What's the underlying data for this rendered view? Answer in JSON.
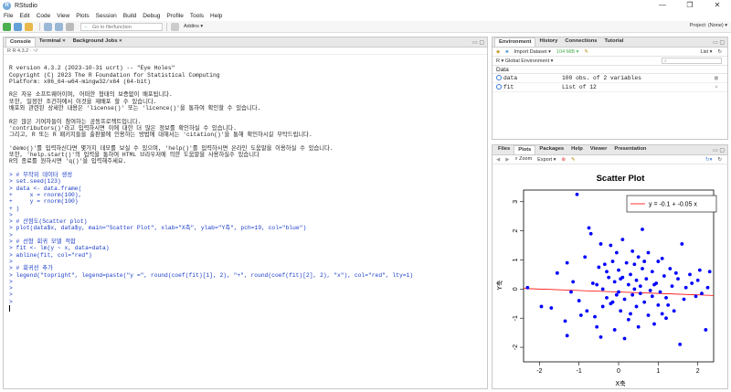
{
  "window": {
    "title": "RStudio"
  },
  "menu": [
    "File",
    "Edit",
    "Code",
    "View",
    "Plots",
    "Session",
    "Build",
    "Debug",
    "Profile",
    "Tools",
    "Help"
  ],
  "toolbar": {
    "goto_placeholder": "Go to file/function",
    "addins": "Addins ▾",
    "project": "Project: (None) ▾"
  },
  "left_pane": {
    "tabs": [
      "Console",
      "Terminal ×",
      "Background Jobs ×"
    ],
    "subheader": "R  R 4.3.2 · ~/",
    "lines": [
      {
        "t": "",
        "c": "out"
      },
      {
        "t": "R version 4.3.2 (2023-10-31 ucrt) -- \"Eye Holes\"",
        "c": "out"
      },
      {
        "t": "Copyright (C) 2023 The R Foundation for Statistical Computing",
        "c": "out"
      },
      {
        "t": "Platform: x86_64-w64-mingw32/x64 (64-bit)",
        "c": "out"
      },
      {
        "t": "",
        "c": "out"
      },
      {
        "t": "R은 자유 소프트웨어이며, 어떠한 형태의 보증없이 배포됩니다.",
        "c": "out"
      },
      {
        "t": "또한, 일정한 조건하에서 이것을 재배포 할 수 있습니다.",
        "c": "out"
      },
      {
        "t": "배포와 관련된 상세한 내용은 'license()' 또는 'licence()'을 통하여 확인할 수 있습니다.",
        "c": "out"
      },
      {
        "t": "",
        "c": "out"
      },
      {
        "t": "R은 많은 기여자들이 참여하는 공동프로젝트입니다.",
        "c": "out"
      },
      {
        "t": "'contributors()'라고 입력하시면 이에 대한 더 많은 정보를 확인하실 수 있습니다.",
        "c": "out"
      },
      {
        "t": "그리고, R 또는 R 패키지들을 출판물에 인용하는 방법에 대해서는 'citation()'을 통해 확인하시길 부탁드립니다.",
        "c": "out"
      },
      {
        "t": "",
        "c": "out"
      },
      {
        "t": "'demo()'를 입력하신다면 몇가지 데모를 보실 수 있으며, 'help()'를 입력하시면 온라인 도움말을 이용하실 수 있습니다.",
        "c": "out"
      },
      {
        "t": "또한, 'help.start()'의 입력을 통하여 HTML 브라우저에 의한 도움말을 사용하실수 있습니다",
        "c": "out"
      },
      {
        "t": "R의 종료를 원하시면 'q()'을 입력해주세요.",
        "c": "out"
      },
      {
        "t": "",
        "c": "out"
      },
      {
        "t": "> # 무작위 데이터 생성",
        "c": "input"
      },
      {
        "t": "> set.seed(123)",
        "c": "input"
      },
      {
        "t": "> data <- data.frame(",
        "c": "input"
      },
      {
        "t": "+     x = rnorm(100),",
        "c": "input"
      },
      {
        "t": "+     y = rnorm(100)",
        "c": "input"
      },
      {
        "t": "+ )",
        "c": "input"
      },
      {
        "t": ">",
        "c": "input"
      },
      {
        "t": "> # 산점도(Scatter plot)",
        "c": "input"
      },
      {
        "t": "> plot(data$x, data$y, main=\"Scatter Plot\", xlab=\"X축\", ylab=\"Y축\", pch=19, col=\"blue\")",
        "c": "input"
      },
      {
        "t": ">",
        "c": "input"
      },
      {
        "t": "> # 선형 회귀 모델 적합",
        "c": "input"
      },
      {
        "t": "> fit <- lm(y ~ x, data=data)",
        "c": "input"
      },
      {
        "t": "> abline(fit, col=\"red\")",
        "c": "input"
      },
      {
        "t": ">",
        "c": "input"
      },
      {
        "t": "> # 회귀선 추가",
        "c": "input"
      },
      {
        "t": "> legend(\"topright\", legend=paste(\"y =\", round(coef(fit)[1], 2), \"+\", round(coef(fit)[2], 2), \"x\"), col=\"red\", lty=1)",
        "c": "input"
      },
      {
        "t": ">",
        "c": "input"
      },
      {
        "t": ">",
        "c": "input"
      },
      {
        "t": ">",
        "c": "input"
      },
      {
        "t": "> ",
        "c": "input",
        "cursor": true
      }
    ]
  },
  "env_pane": {
    "tabs": [
      "Environment",
      "History",
      "Connections",
      "Tutorial"
    ],
    "toolbar": {
      "import": "Import Dataset ▾",
      "mem": "104 MiB ▾",
      "list": "List ▾"
    },
    "scope": "R ▾   Global Environment ▾",
    "section": "Data",
    "rows": [
      {
        "name": "data",
        "value": "100 obs. of 2 variables"
      },
      {
        "name": "fit",
        "value": "List of  12"
      }
    ]
  },
  "plots_pane": {
    "tabs": [
      "Files",
      "Plots",
      "Packages",
      "Help",
      "Viewer",
      "Presentation"
    ],
    "toolbar": {
      "zoom": "Zoom",
      "export": "Export ▾"
    }
  },
  "chart_data": {
    "type": "scatter",
    "title": "Scatter Plot",
    "xlabel": "X축",
    "ylabel": "Y축",
    "xlim": [
      -2.4,
      2.4
    ],
    "ylim": [
      -2.5,
      3.4
    ],
    "xticks": [
      -2,
      -1,
      0,
      1,
      2
    ],
    "yticks": [
      -2,
      -1,
      0,
      1,
      2,
      3
    ],
    "point_color": "#0000ff",
    "line_color": "#ff0000",
    "regression": {
      "intercept": -0.1,
      "slope": -0.05
    },
    "legend": "y = -0.1 + -0.05 x",
    "points": [
      [
        -2.3,
        0.05
      ],
      [
        -1.95,
        -0.6
      ],
      [
        -1.7,
        -0.65
      ],
      [
        -1.55,
        0.55
      ],
      [
        -1.35,
        -1.1
      ],
      [
        -1.3,
        -1.6
      ],
      [
        -1.3,
        0.9
      ],
      [
        -1.2,
        -0.1
      ],
      [
        -1.05,
        3.25
      ],
      [
        -1.0,
        -0.4
      ],
      [
        -0.95,
        -0.9
      ],
      [
        -0.85,
        1.1
      ],
      [
        -0.75,
        2.1
      ],
      [
        -0.7,
        1.9
      ],
      [
        -0.65,
        0.2
      ],
      [
        -0.6,
        -0.95
      ],
      [
        -0.55,
        -1.3
      ],
      [
        -0.5,
        0.75
      ],
      [
        -0.45,
        1.55
      ],
      [
        -0.45,
        -1.65
      ],
      [
        -0.4,
        0.0
      ],
      [
        -0.35,
        0.85
      ],
      [
        -0.3,
        -0.3
      ],
      [
        -0.25,
        0.4
      ],
      [
        -0.2,
        1.5
      ],
      [
        -0.2,
        -0.5
      ],
      [
        -0.15,
        0.95
      ],
      [
        -0.1,
        -1.4
      ],
      [
        -0.1,
        0.25
      ],
      [
        -0.05,
        1.25
      ],
      [
        0.0,
        -0.1
      ],
      [
        0.0,
        0.65
      ],
      [
        0.05,
        -0.75
      ],
      [
        0.1,
        0.4
      ],
      [
        0.1,
        1.7
      ],
      [
        0.15,
        -0.35
      ],
      [
        0.2,
        0.9
      ],
      [
        0.25,
        0.15
      ],
      [
        0.25,
        -1.05
      ],
      [
        0.3,
        0.5
      ],
      [
        0.35,
        1.3
      ],
      [
        0.35,
        -0.2
      ],
      [
        0.4,
        0.85
      ],
      [
        0.45,
        0.3
      ],
      [
        0.45,
        -0.6
      ],
      [
        0.5,
        1.1
      ],
      [
        0.5,
        -1.3
      ],
      [
        0.55,
        0.1
      ],
      [
        0.6,
        0.7
      ],
      [
        0.6,
        2.05
      ],
      [
        0.65,
        -0.45
      ],
      [
        0.7,
        0.35
      ],
      [
        0.75,
        -0.9
      ],
      [
        0.75,
        1.25
      ],
      [
        0.8,
        -0.05
      ],
      [
        0.85,
        0.6
      ],
      [
        0.9,
        -1.2
      ],
      [
        0.95,
        0.2
      ],
      [
        1.0,
        0.95
      ],
      [
        1.0,
        -0.55
      ],
      [
        1.05,
        -0.1
      ],
      [
        1.1,
        1.05
      ],
      [
        1.15,
        0.45
      ],
      [
        1.2,
        -0.3
      ],
      [
        1.2,
        -1.0
      ],
      [
        1.3,
        0.7
      ],
      [
        1.35,
        0.1
      ],
      [
        1.4,
        -0.75
      ],
      [
        1.5,
        0.35
      ],
      [
        1.55,
        -1.9
      ],
      [
        1.6,
        1.55
      ],
      [
        1.65,
        -0.35
      ],
      [
        1.7,
        0.05
      ],
      [
        1.8,
        0.5
      ],
      [
        1.85,
        0.2
      ],
      [
        1.95,
        -0.25
      ],
      [
        2.0,
        0.3
      ],
      [
        2.05,
        0.65
      ],
      [
        2.1,
        -0.15
      ],
      [
        2.2,
        -1.4
      ],
      [
        2.25,
        0.05
      ],
      [
        2.3,
        0.6
      ],
      [
        -0.8,
        -0.75
      ],
      [
        -0.05,
        -0.2
      ],
      [
        0.4,
        0.0
      ],
      [
        0.65,
        0.95
      ],
      [
        -0.3,
        0.6
      ],
      [
        0.15,
        -1.7
      ],
      [
        1.25,
        -0.55
      ],
      [
        -1.15,
        0.25
      ],
      [
        0.55,
        -0.15
      ],
      [
        0.85,
        -0.25
      ],
      [
        -0.55,
        0.15
      ],
      [
        0.3,
        -0.85
      ],
      [
        1.45,
        0.55
      ],
      [
        -0.15,
        -0.45
      ],
      [
        0.05,
        0.35
      ],
      [
        0.9,
        0.15
      ],
      [
        1.1,
        -0.85
      ],
      [
        -0.4,
        -0.6
      ]
    ]
  }
}
